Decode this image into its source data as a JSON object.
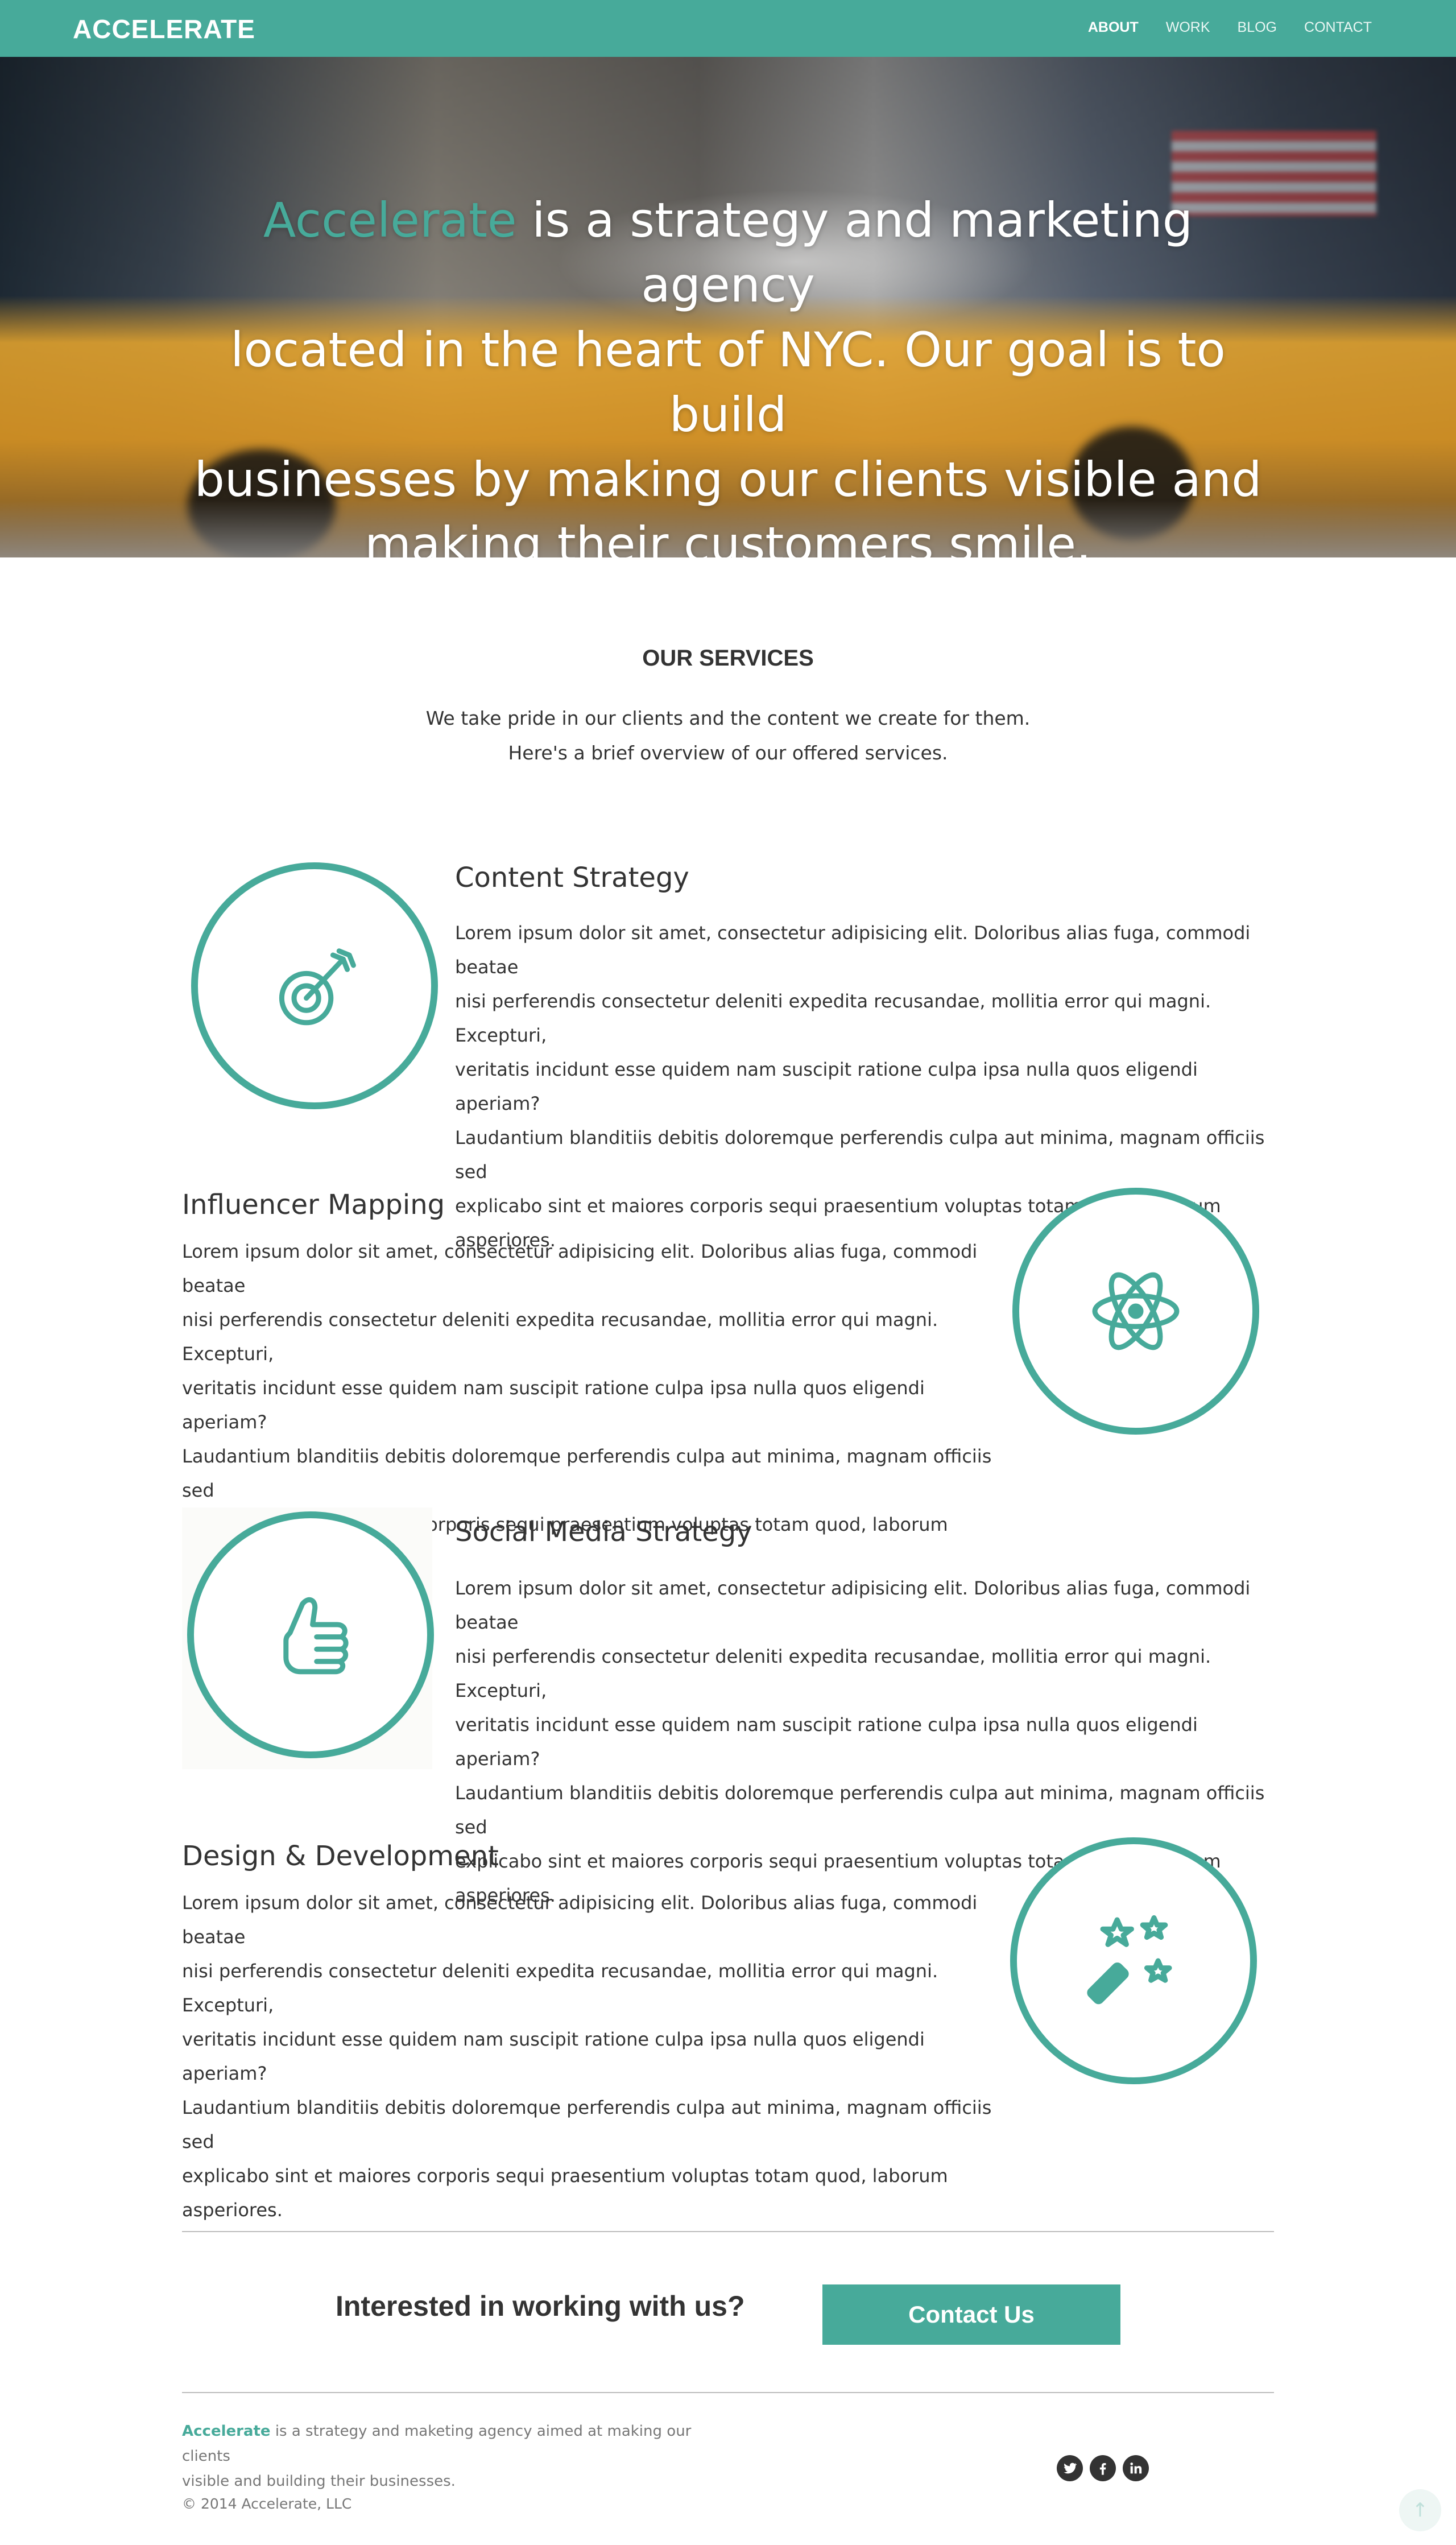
{
  "header": {
    "logo": "ACCELERATE",
    "nav": [
      "ABOUT",
      "WORK",
      "BLOG",
      "CONTACT"
    ],
    "active_nav": "ABOUT"
  },
  "hero": {
    "brand": "Accelerate",
    "line1_rest": " is a strategy and marketing agency",
    "line2": "located in the heart of NYC. Our goal is to build",
    "line3": "businesses by making our clients visible and",
    "line4": "making their customers smile."
  },
  "services": {
    "title": "OUR SERVICES",
    "intro1": "We take pride in our clients and the content we create for them.",
    "intro2": "Here's a brief overview of our offered services.",
    "items": [
      {
        "name": "Content Strategy",
        "icon": "target-arrow-icon",
        "lines": [
          "Lorem ipsum dolor sit amet, consectetur adipisicing elit. Doloribus alias fuga, commodi beatae",
          "nisi perferendis consectetur deleniti expedita recusandae, mollitia error qui magni. Excepturi,",
          "veritatis incidunt esse quidem nam suscipit ratione culpa ipsa nulla quos eligendi aperiam?",
          "Laudantium blanditiis debitis doloremque perferendis culpa aut minima, magnam officiis sed",
          "explicabo sint et maiores corporis sequi praesentium voluptas totam quod, laborum asperiores."
        ]
      },
      {
        "name": "Influencer Mapping",
        "icon": "atom-icon",
        "lines": [
          "Lorem ipsum dolor sit amet, consectetur adipisicing elit. Doloribus alias fuga, commodi beatae",
          "nisi perferendis consectetur deleniti expedita recusandae, mollitia error qui magni. Excepturi,",
          "veritatis incidunt esse quidem nam suscipit ratione culpa ipsa nulla quos eligendi aperiam?",
          "Laudantium blanditiis debitis doloremque perferendis culpa aut minima, magnam officiis sed",
          "explicabo sint et maiores corporis sequi praesentium voluptas totam quod, laborum asperiores."
        ]
      },
      {
        "name": "Social Media Strategy",
        "icon": "thumbs-up-icon",
        "lines": [
          "Lorem ipsum dolor sit amet, consectetur adipisicing elit. Doloribus alias fuga, commodi beatae",
          "nisi perferendis consectetur deleniti expedita recusandae, mollitia error qui magni. Excepturi,",
          "veritatis incidunt esse quidem nam suscipit ratione culpa ipsa nulla quos eligendi aperiam?",
          "Laudantium blanditiis debitis doloremque perferendis culpa aut minima, magnam officiis sed",
          "explicabo sint et maiores corporis sequi praesentium voluptas totam quod, laborum asperiores."
        ]
      },
      {
        "name": "Design & Development",
        "icon": "magic-wand-icon",
        "lines": [
          "Lorem ipsum dolor sit amet, consectetur adipisicing elit. Doloribus alias fuga, commodi beatae",
          "nisi perferendis consectetur deleniti expedita recusandae, mollitia error qui magni. Excepturi,",
          "veritatis incidunt esse quidem nam suscipit ratione culpa ipsa nulla quos eligendi aperiam?",
          "Laudantium blanditiis debitis doloremque perferendis culpa aut minima, magnam officiis sed",
          "explicabo sint et maiores corporis sequi praesentium voluptas totam quod, laborum asperiores."
        ]
      }
    ]
  },
  "cta": {
    "question": "Interested in working with us?",
    "button": "Contact Us"
  },
  "footer": {
    "brand": "Accelerate",
    "about_rest": " is a strategy and maketing agency aimed at making our clients",
    "about_line2": "visible and building their businesses.",
    "copyright": "© 2014 Accelerate, LLC",
    "socials": [
      "twitter-icon",
      "facebook-icon",
      "linkedin-icon"
    ],
    "to_top": "↑"
  },
  "colors": {
    "accent": "#47aa9a",
    "text": "#333333",
    "muted": "#777777"
  }
}
